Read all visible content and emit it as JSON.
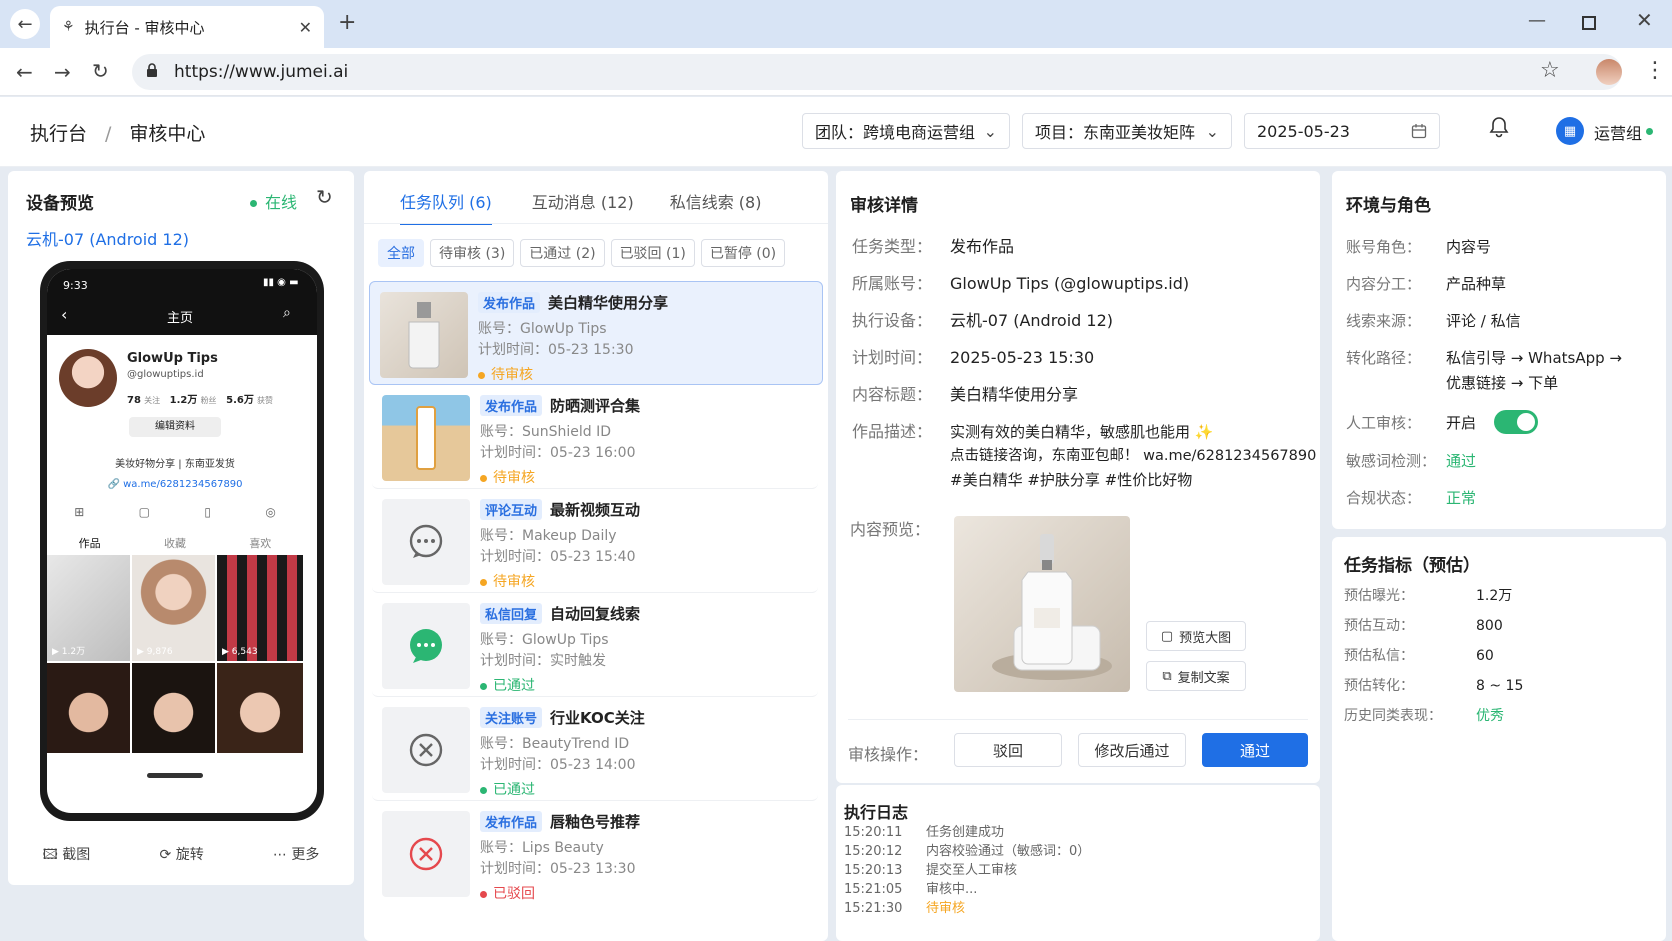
{
  "browser": {
    "tab_title": "执行台 - 审核中心",
    "url": "https://www.jumei.ai"
  },
  "header": {
    "crumb1": "执行台",
    "crumb_sep": "/",
    "crumb2": "审核中心",
    "team": "团队：跨境电商运营组",
    "project": "项目：东南亚美妆矩阵",
    "date": "2025-05-23",
    "user": "运营组"
  },
  "device": {
    "title": "设备预览",
    "status": "在线",
    "name": "云机-07 (Android 12)",
    "phone": {
      "time": "9:33",
      "nav_title": "主页",
      "profile_name": "GlowUp Tips",
      "handle": "@glowuptips.id",
      "follow": "78",
      "follow_label": "关注",
      "fans": "1.2万",
      "fans_label": "粉丝",
      "likes": "5.6万",
      "likes_label": "获赞",
      "edit": "编辑资料",
      "bio": "美妆好物分享 | 东南亚发货",
      "link": "wa.me/6281234567890",
      "tab_works": "作品",
      "tab_fav": "收藏",
      "tab_like": "喜欢",
      "views": [
        "1.2万",
        "9,876",
        "6,543"
      ]
    },
    "actions": {
      "shot": "截图",
      "rotate": "旋转",
      "more": "更多"
    }
  },
  "queue": {
    "tabs": [
      "任务队列 (6)",
      "互动消息 (12)",
      "私信线索 (8)"
    ],
    "filters": [
      "全部",
      "待审核 (3)",
      "已通过 (2)",
      "已驳回 (1)",
      "已暂停 (0)"
    ],
    "tasks": [
      {
        "tag": "发布作品",
        "title": "美白精华使用分享",
        "account": "账号：GlowUp Tips",
        "time": "计划时间：05-23 15:30",
        "status": "待审核"
      },
      {
        "tag": "发布作品",
        "title": "防晒测评合集",
        "account": "账号：SunShield ID",
        "time": "计划时间：05-23 16:00",
        "status": "待审核"
      },
      {
        "tag": "评论互动",
        "title": "最新视频互动",
        "account": "账号：Makeup Daily",
        "time": "计划时间：05-23 15:40",
        "status": "待审核"
      },
      {
        "tag": "私信回复",
        "title": "自动回复线索",
        "account": "账号：GlowUp Tips",
        "time": "计划时间：实时触发",
        "status": "已通过"
      },
      {
        "tag": "关注账号",
        "title": "行业KOC关注",
        "account": "账号：BeautyTrend ID",
        "time": "计划时间：05-23 14:00",
        "status": "已通过"
      },
      {
        "tag": "发布作品",
        "title": "唇釉色号推荐",
        "account": "账号：Lips Beauty",
        "time": "计划时间：05-23 13:30",
        "status": "已驳回"
      }
    ]
  },
  "detail": {
    "title": "审核详情",
    "rows": [
      {
        "k": "任务类型：",
        "v": "发布作品"
      },
      {
        "k": "所属账号：",
        "v": "GlowUp Tips (@glowuptips.id)"
      },
      {
        "k": "执行设备：",
        "v": "云机-07 (Android 12)"
      },
      {
        "k": "计划时间：",
        "v": "2025-05-23 15:30"
      },
      {
        "k": "内容标题：",
        "v": "美白精华使用分享"
      }
    ],
    "desc_label": "作品描述：",
    "desc": [
      "实测有效的美白精华，敏感肌也能用 ✨",
      "点击链接咨询，东南亚包邮！ wa.me/6281234567890",
      "#美白精华 #护肤分享 #性价比好物"
    ],
    "preview_label": "内容预览：",
    "btn_preview": "预览大图",
    "btn_copy": "复制文案",
    "ops_label": "审核操作：",
    "btn_reject": "驳回",
    "btn_modify": "修改后通过",
    "btn_pass": "通过"
  },
  "log": {
    "title": "执行日志",
    "items": [
      {
        "t": "15:20:11",
        "m": "任务创建成功"
      },
      {
        "t": "15:20:12",
        "m": "内容校验通过（敏感词：0）"
      },
      {
        "t": "15:20:13",
        "m": "提交至人工审核"
      },
      {
        "t": "15:21:05",
        "m": "审核中..."
      },
      {
        "t": "15:21:30",
        "m": "待审核"
      }
    ]
  },
  "env": {
    "title": "环境与角色",
    "rows": [
      {
        "k": "账号角色：",
        "v": "内容号"
      },
      {
        "k": "内容分工：",
        "v": "产品种草"
      },
      {
        "k": "线索来源：",
        "v": "评论 / 私信"
      },
      {
        "k": "转化路径：",
        "v": "私信引导 → WhatsApp →",
        "v2": "优惠链接 → 下单"
      }
    ],
    "manual": {
      "k": "人工审核：",
      "v": "开启"
    },
    "sensitive": {
      "k": "敏感词检测：",
      "v": "通过"
    },
    "compliance": {
      "k": "合规状态：",
      "v": "正常"
    }
  },
  "metrics": {
    "title": "任务指标（预估）",
    "rows": [
      {
        "k": "预估曝光：",
        "v": "1.2万"
      },
      {
        "k": "预估互动：",
        "v": "800"
      },
      {
        "k": "预估私信：",
        "v": "60"
      },
      {
        "k": "预估转化：",
        "v": "8 ~ 15"
      },
      {
        "k": "历史同类表现：",
        "v": "优秀"
      }
    ]
  },
  "colors": {
    "accent": "#1f6fe5",
    "green": "#2bb673",
    "orange": "#f5a623",
    "red": "#e5484d"
  }
}
